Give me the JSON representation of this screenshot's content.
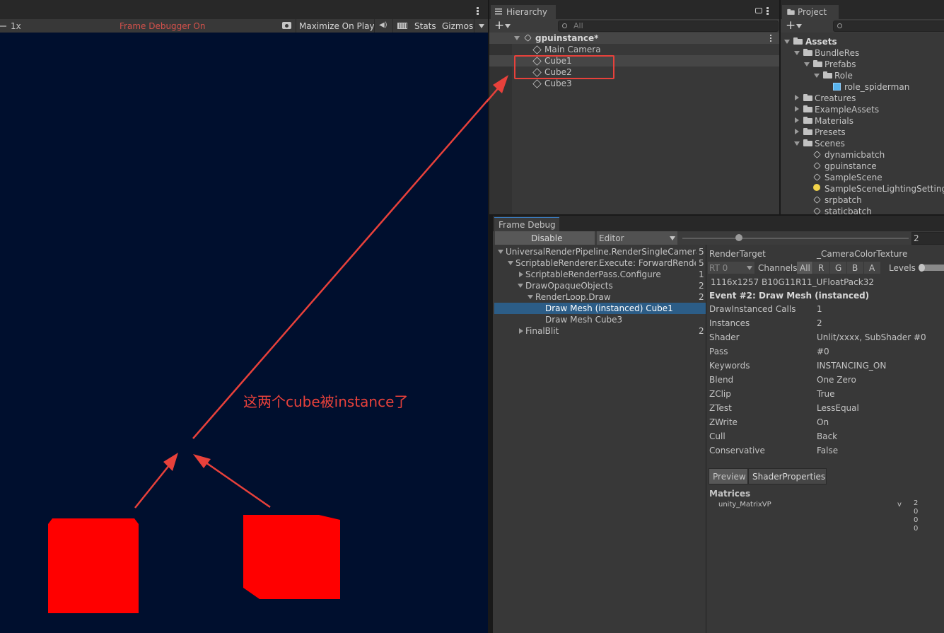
{
  "game_view": {
    "scale_label": "1x",
    "frame_debugger_status": "Frame Debugger On",
    "maximize_on_play": "Maximize On Play",
    "stats": "Stats",
    "gizmos": "Gizmos",
    "annotation": "这两个cube被instance了",
    "annotation_color": "#e8413b",
    "background_color": "#000f2e",
    "cube_color": "#ff0000"
  },
  "hierarchy": {
    "tab_label": "Hierarchy",
    "search_placeholder": "All",
    "scene_name": "gpuinstance*",
    "items": [
      {
        "label": "Main Camera"
      },
      {
        "label": "Cube1"
      },
      {
        "label": "Cube2"
      },
      {
        "label": "Cube3"
      }
    ]
  },
  "project": {
    "tab_label": "Project",
    "tree": [
      {
        "label": "Assets"
      },
      {
        "label": "BundleRes"
      },
      {
        "label": "Prefabs"
      },
      {
        "label": "Role"
      },
      {
        "label": "role_spiderman"
      },
      {
        "label": "Creatures"
      },
      {
        "label": "ExampleAssets"
      },
      {
        "label": "Materials"
      },
      {
        "label": "Presets"
      },
      {
        "label": "Scenes"
      },
      {
        "label": "dynamicbatch"
      },
      {
        "label": "gpuinstance"
      },
      {
        "label": "SampleScene"
      },
      {
        "label": "SampleSceneLightingSettings"
      },
      {
        "label": "srpbatch"
      },
      {
        "label": "staticbatch"
      }
    ]
  },
  "frame_debug": {
    "tab_label": "Frame Debug",
    "disable_button": "Disable",
    "target_dropdown": "Editor",
    "slider_value": "2",
    "events": [
      {
        "label": "UniversalRenderPipeline.RenderSingleCamera: M",
        "count": "5"
      },
      {
        "label": "ScriptableRenderer.Execute: ForwardRendere",
        "count": "5"
      },
      {
        "label": "ScriptableRenderPass.Configure",
        "count": "1"
      },
      {
        "label": "DrawOpaqueObjects",
        "count": "2"
      },
      {
        "label": "RenderLoop.Draw",
        "count": "2"
      },
      {
        "label": "Draw Mesh (instanced) Cube1",
        "count": ""
      },
      {
        "label": "Draw Mesh Cube3",
        "count": ""
      },
      {
        "label": "FinalBlit",
        "count": "2"
      }
    ],
    "render_target_label": "RenderTarget",
    "render_target_value": "_CameraColorTexture",
    "rt_dropdown": "RT 0",
    "channels_label": "Channels",
    "channels": [
      "All",
      "R",
      "G",
      "B",
      "A"
    ],
    "levels_label": "Levels",
    "format": "1116x1257 B10G11R11_UFloatPack32",
    "event_title": "Event #2: Draw Mesh (instanced)",
    "properties": [
      {
        "key": "DrawInstanced Calls",
        "value": "1"
      },
      {
        "key": "Instances",
        "value": "2"
      },
      {
        "key": "Shader",
        "value": "Unlit/xxxx, SubShader #0"
      },
      {
        "key": "Pass",
        "value": "#0"
      },
      {
        "key": "Keywords",
        "value": "INSTANCING_ON"
      },
      {
        "key": "Blend",
        "value": "One Zero"
      },
      {
        "key": "ZClip",
        "value": "True"
      },
      {
        "key": "ZTest",
        "value": "LessEqual"
      },
      {
        "key": "ZWrite",
        "value": "On"
      },
      {
        "key": "Cull",
        "value": "Back"
      },
      {
        "key": "Conservative",
        "value": "False"
      }
    ],
    "preview_tab": "Preview",
    "shader_props_tab": "ShaderProperties",
    "matrices_title": "Matrices",
    "matrix_name": "unity_MatrixVP",
    "matrix_type": "v",
    "matrix_values": [
      "2",
      "0",
      "0",
      "0"
    ]
  }
}
